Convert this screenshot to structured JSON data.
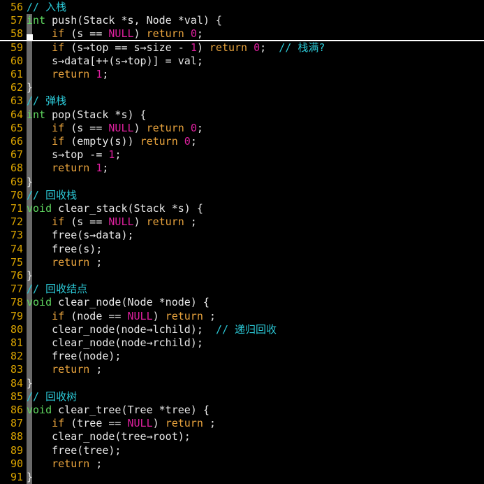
{
  "editor": {
    "name": "code-editor",
    "language": "C",
    "theme": {
      "background": "#000000",
      "linenumber": "#d9a300",
      "comment": "#2bc8d6",
      "keyword": "#5fd75f",
      "control": "#e8a33d",
      "number": "#e020a0",
      "constant": "#e020a0",
      "plain": "#e8e8e8",
      "cursorline_underline": "#ffffff",
      "indent_guide": "#6a6a6a"
    },
    "first_line": 56,
    "last_line": 91,
    "active_line": 58
  },
  "lines": [
    {
      "no": "56",
      "active": false,
      "tokens": [
        {
          "c": "cmt",
          "t": "// 入栈"
        }
      ]
    },
    {
      "no": "57",
      "active": false,
      "tokens": [
        {
          "c": "kw",
          "t": "int"
        },
        {
          "c": "plain",
          "t": " push(Stack *s, Node *val) {"
        }
      ]
    },
    {
      "no": "58",
      "active": true,
      "tokens": [
        {
          "c": "plain",
          "t": "    "
        },
        {
          "c": "ctl",
          "t": "if"
        },
        {
          "c": "plain",
          "t": " (s == "
        },
        {
          "c": "const",
          "t": "NULL"
        },
        {
          "c": "plain",
          "t": ") "
        },
        {
          "c": "ctl",
          "t": "return"
        },
        {
          "c": "plain",
          "t": " "
        },
        {
          "c": "num",
          "t": "0"
        },
        {
          "c": "plain",
          "t": ";"
        }
      ]
    },
    {
      "no": "59",
      "active": false,
      "tokens": [
        {
          "c": "plain",
          "t": "    "
        },
        {
          "c": "ctl",
          "t": "if"
        },
        {
          "c": "plain",
          "t": " (s→top == s→size - "
        },
        {
          "c": "num",
          "t": "1"
        },
        {
          "c": "plain",
          "t": ") "
        },
        {
          "c": "ctl",
          "t": "return"
        },
        {
          "c": "plain",
          "t": " "
        },
        {
          "c": "num",
          "t": "0"
        },
        {
          "c": "plain",
          "t": ";  "
        },
        {
          "c": "cmt",
          "t": "// 栈满?"
        }
      ]
    },
    {
      "no": "60",
      "active": false,
      "tokens": [
        {
          "c": "plain",
          "t": "    s→data[++(s→top)] = val;"
        }
      ]
    },
    {
      "no": "61",
      "active": false,
      "tokens": [
        {
          "c": "plain",
          "t": "    "
        },
        {
          "c": "ctl",
          "t": "return"
        },
        {
          "c": "plain",
          "t": " "
        },
        {
          "c": "num",
          "t": "1"
        },
        {
          "c": "plain",
          "t": ";"
        }
      ]
    },
    {
      "no": "62",
      "active": false,
      "tokens": [
        {
          "c": "plain",
          "t": "}"
        }
      ]
    },
    {
      "no": "63",
      "active": false,
      "tokens": [
        {
          "c": "cmt",
          "t": "// 弹栈"
        }
      ]
    },
    {
      "no": "64",
      "active": false,
      "tokens": [
        {
          "c": "kw",
          "t": "int"
        },
        {
          "c": "plain",
          "t": " pop(Stack *s) {"
        }
      ]
    },
    {
      "no": "65",
      "active": false,
      "tokens": [
        {
          "c": "plain",
          "t": "    "
        },
        {
          "c": "ctl",
          "t": "if"
        },
        {
          "c": "plain",
          "t": " (s == "
        },
        {
          "c": "const",
          "t": "NULL"
        },
        {
          "c": "plain",
          "t": ") "
        },
        {
          "c": "ctl",
          "t": "return"
        },
        {
          "c": "plain",
          "t": " "
        },
        {
          "c": "num",
          "t": "0"
        },
        {
          "c": "plain",
          "t": ";"
        }
      ]
    },
    {
      "no": "66",
      "active": false,
      "tokens": [
        {
          "c": "plain",
          "t": "    "
        },
        {
          "c": "ctl",
          "t": "if"
        },
        {
          "c": "plain",
          "t": " (empty(s)) "
        },
        {
          "c": "ctl",
          "t": "return"
        },
        {
          "c": "plain",
          "t": " "
        },
        {
          "c": "num",
          "t": "0"
        },
        {
          "c": "plain",
          "t": ";"
        }
      ]
    },
    {
      "no": "67",
      "active": false,
      "tokens": [
        {
          "c": "plain",
          "t": "    s→top -= "
        },
        {
          "c": "num",
          "t": "1"
        },
        {
          "c": "plain",
          "t": ";"
        }
      ]
    },
    {
      "no": "68",
      "active": false,
      "tokens": [
        {
          "c": "plain",
          "t": "    "
        },
        {
          "c": "ctl",
          "t": "return"
        },
        {
          "c": "plain",
          "t": " "
        },
        {
          "c": "num",
          "t": "1"
        },
        {
          "c": "plain",
          "t": ";"
        }
      ]
    },
    {
      "no": "69",
      "active": false,
      "tokens": [
        {
          "c": "plain",
          "t": "}"
        }
      ]
    },
    {
      "no": "70",
      "active": false,
      "tokens": [
        {
          "c": "cmt",
          "t": "// 回收栈"
        }
      ]
    },
    {
      "no": "71",
      "active": false,
      "tokens": [
        {
          "c": "kw",
          "t": "void"
        },
        {
          "c": "plain",
          "t": " clear_stack(Stack *s) {"
        }
      ]
    },
    {
      "no": "72",
      "active": false,
      "tokens": [
        {
          "c": "plain",
          "t": "    "
        },
        {
          "c": "ctl",
          "t": "if"
        },
        {
          "c": "plain",
          "t": " (s == "
        },
        {
          "c": "const",
          "t": "NULL"
        },
        {
          "c": "plain",
          "t": ") "
        },
        {
          "c": "ctl",
          "t": "return"
        },
        {
          "c": "plain",
          "t": " ;"
        }
      ]
    },
    {
      "no": "73",
      "active": false,
      "tokens": [
        {
          "c": "plain",
          "t": "    free(s→data);"
        }
      ]
    },
    {
      "no": "74",
      "active": false,
      "tokens": [
        {
          "c": "plain",
          "t": "    free(s);"
        }
      ]
    },
    {
      "no": "75",
      "active": false,
      "tokens": [
        {
          "c": "plain",
          "t": "    "
        },
        {
          "c": "ctl",
          "t": "return"
        },
        {
          "c": "plain",
          "t": " ;"
        }
      ]
    },
    {
      "no": "76",
      "active": false,
      "tokens": [
        {
          "c": "plain",
          "t": "}"
        }
      ]
    },
    {
      "no": "77",
      "active": false,
      "tokens": [
        {
          "c": "cmt",
          "t": "// 回收结点"
        }
      ]
    },
    {
      "no": "78",
      "active": false,
      "tokens": [
        {
          "c": "kw",
          "t": "void"
        },
        {
          "c": "plain",
          "t": " clear_node(Node *node) {"
        }
      ]
    },
    {
      "no": "79",
      "active": false,
      "tokens": [
        {
          "c": "plain",
          "t": "    "
        },
        {
          "c": "ctl",
          "t": "if"
        },
        {
          "c": "plain",
          "t": " (node == "
        },
        {
          "c": "const",
          "t": "NULL"
        },
        {
          "c": "plain",
          "t": ") "
        },
        {
          "c": "ctl",
          "t": "return"
        },
        {
          "c": "plain",
          "t": " ;"
        }
      ]
    },
    {
      "no": "80",
      "active": false,
      "tokens": [
        {
          "c": "plain",
          "t": "    clear_node(node→lchild);  "
        },
        {
          "c": "cmt",
          "t": "// 递归回收"
        }
      ]
    },
    {
      "no": "81",
      "active": false,
      "tokens": [
        {
          "c": "plain",
          "t": "    clear_node(node→rchild);"
        }
      ]
    },
    {
      "no": "82",
      "active": false,
      "tokens": [
        {
          "c": "plain",
          "t": "    free(node);"
        }
      ]
    },
    {
      "no": "83",
      "active": false,
      "tokens": [
        {
          "c": "plain",
          "t": "    "
        },
        {
          "c": "ctl",
          "t": "return"
        },
        {
          "c": "plain",
          "t": " ;"
        }
      ]
    },
    {
      "no": "84",
      "active": false,
      "tokens": [
        {
          "c": "plain",
          "t": "}"
        }
      ]
    },
    {
      "no": "85",
      "active": false,
      "tokens": [
        {
          "c": "cmt",
          "t": "// 回收树"
        }
      ]
    },
    {
      "no": "86",
      "active": false,
      "tokens": [
        {
          "c": "kw",
          "t": "void"
        },
        {
          "c": "plain",
          "t": " clear_tree(Tree *tree) {"
        }
      ]
    },
    {
      "no": "87",
      "active": false,
      "tokens": [
        {
          "c": "plain",
          "t": "    "
        },
        {
          "c": "ctl",
          "t": "if"
        },
        {
          "c": "plain",
          "t": " (tree == "
        },
        {
          "c": "const",
          "t": "NULL"
        },
        {
          "c": "plain",
          "t": ") "
        },
        {
          "c": "ctl",
          "t": "return"
        },
        {
          "c": "plain",
          "t": " ;"
        }
      ]
    },
    {
      "no": "88",
      "active": false,
      "tokens": [
        {
          "c": "plain",
          "t": "    clear_node(tree→root);"
        }
      ]
    },
    {
      "no": "89",
      "active": false,
      "tokens": [
        {
          "c": "plain",
          "t": "    free(tree);"
        }
      ]
    },
    {
      "no": "90",
      "active": false,
      "tokens": [
        {
          "c": "plain",
          "t": "    "
        },
        {
          "c": "ctl",
          "t": "return"
        },
        {
          "c": "plain",
          "t": " ;"
        }
      ]
    },
    {
      "no": "91",
      "active": false,
      "tokens": [
        {
          "c": "plain",
          "t": "}"
        }
      ]
    }
  ]
}
